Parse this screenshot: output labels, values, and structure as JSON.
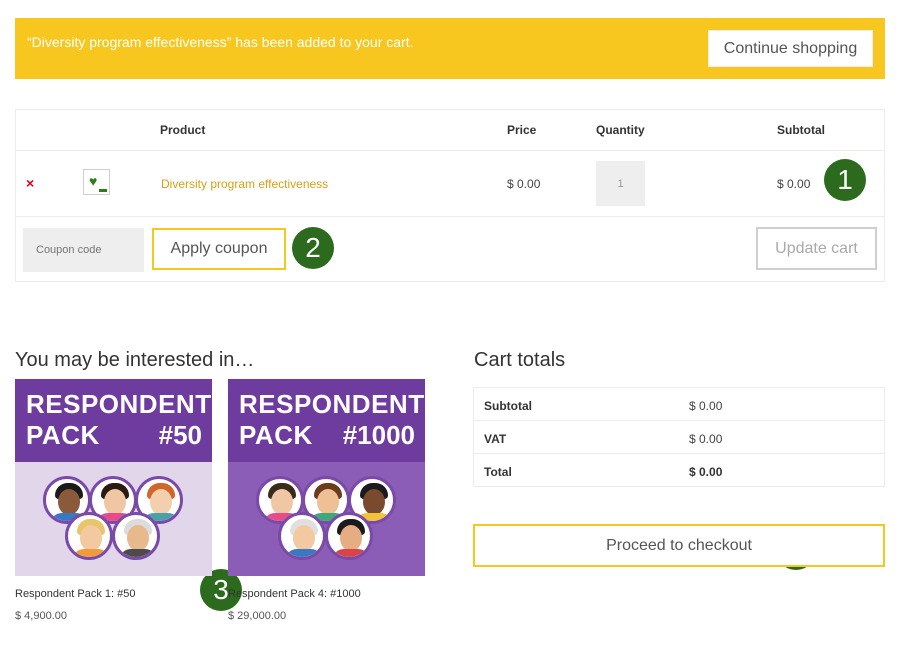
{
  "notice": {
    "message": "“Diversity program effectiveness” has been added to your cart.",
    "continue_label": "Continue shopping"
  },
  "cart": {
    "headers": {
      "product": "Product",
      "price": "Price",
      "quantity": "Quantity",
      "subtotal": "Subtotal"
    },
    "item": {
      "remove_symbol": "×",
      "name": "Diversity program effectiveness",
      "price": "$ 0.00",
      "quantity": "1",
      "subtotal": "$ 0.00",
      "thumb_icon": "heart-icon"
    },
    "coupon_placeholder": "Coupon code",
    "apply_label": "Apply coupon",
    "update_label": "Update cart"
  },
  "badges": [
    "1",
    "2",
    "3",
    "4"
  ],
  "related": {
    "title": "You may be interested in…",
    "products": [
      {
        "line1": "RESPONDENT",
        "line2": "PACK",
        "number": "#50",
        "name": "Respondent Pack 1: #50",
        "price": "$ 4,900.00",
        "bg_color": "#e2d6ea"
      },
      {
        "line1": "RESPONDENT",
        "line2": "PACK",
        "number": "#1000",
        "name": "Respondent Pack 4: #1000",
        "price": "$ 29,000.00",
        "bg_color": "#8c5db6"
      }
    ]
  },
  "totals": {
    "title": "Cart totals",
    "rows": [
      {
        "label": "Subtotal",
        "value": "$ 0.00"
      },
      {
        "label": "VAT",
        "value": "$ 0.00"
      },
      {
        "label": "Total",
        "value": "$ 0.00"
      }
    ],
    "checkout_label": "Proceed to checkout"
  },
  "colors": {
    "notice_bg": "#f7c71f",
    "accent": "#f7c71f",
    "link": "#d4a017",
    "badge": "#2c6b1e",
    "pack_purple": "#6e3b9e",
    "remove": "#e2001a"
  }
}
